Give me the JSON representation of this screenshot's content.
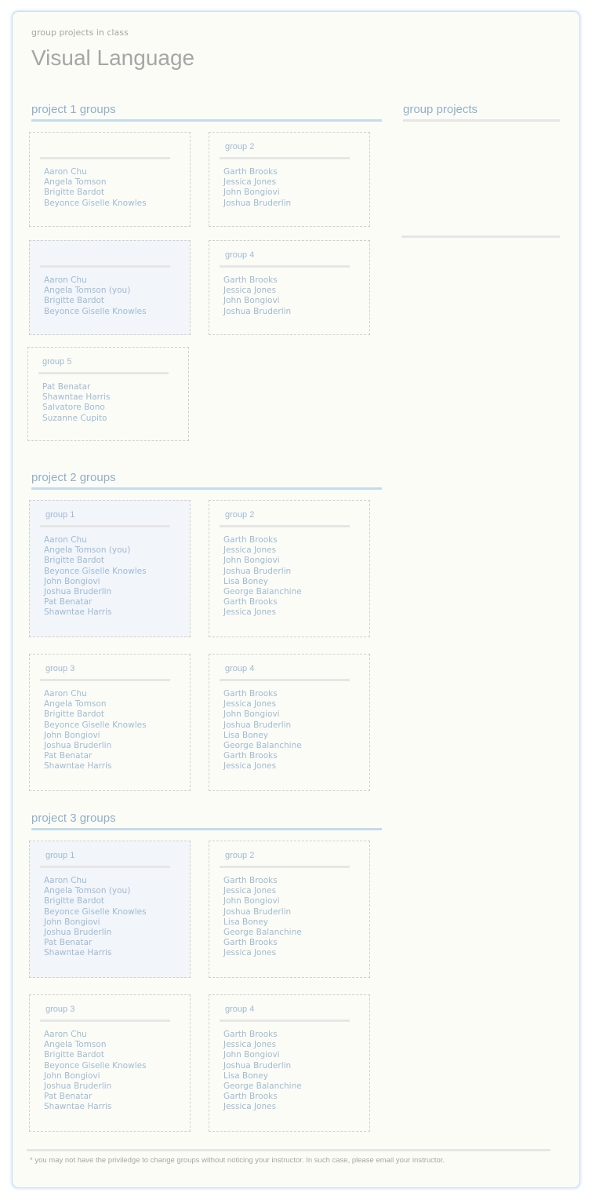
{
  "header": {
    "subtitle": "group projects in class",
    "title": "Visual Language"
  },
  "sidebar": {
    "heading": "group projects"
  },
  "projects": [
    {
      "heading": "project 1 groups",
      "groups": [
        {
          "name": "",
          "members": [
            "Aaron Chu",
            "Angela Tomson",
            "Brigitte Bardot",
            "Beyonce Giselle Knowles"
          ],
          "current": false
        },
        {
          "name": "group 2",
          "members": [
            "Garth Brooks",
            "Jessica Jones",
            "John Bongiovi",
            "Joshua Bruderlin"
          ],
          "current": false
        },
        {
          "name": "",
          "members": [
            "Aaron Chu",
            "Angela Tomson (you)",
            "Brigitte Bardot",
            "Beyonce Giselle Knowles"
          ],
          "current": true
        },
        {
          "name": "group 4",
          "members": [
            "Garth Brooks",
            "Jessica Jones",
            "John Bongiovi",
            "Joshua Bruderlin"
          ],
          "current": false
        },
        {
          "name": "group 5",
          "members": [
            "Pat Benatar",
            "Shawntae Harris",
            "Salvatore Bono",
            "Suzanne Cupito"
          ],
          "current": false
        }
      ]
    },
    {
      "heading": "project 2 groups",
      "groups": [
        {
          "name": "group 1",
          "members": [
            "Aaron Chu",
            "Angela Tomson (you)",
            "Brigitte Bardot",
            "Beyonce Giselle Knowles",
            "John Bongiovi",
            "Joshua Bruderlin",
            "Pat Benatar",
            "Shawntae Harris"
          ],
          "current": true
        },
        {
          "name": "group 2",
          "members": [
            "Garth Brooks",
            "Jessica Jones",
            "John Bongiovi",
            "Joshua Bruderlin",
            "Lisa Boney",
            "George Balanchine",
            "Garth Brooks",
            "Jessica Jones"
          ],
          "current": false
        },
        {
          "name": "group 3",
          "members": [
            "Aaron Chu",
            "Angela Tomson",
            "Brigitte Bardot",
            "Beyonce Giselle Knowles",
            "John Bongiovi",
            "Joshua Bruderlin",
            "Pat Benatar",
            "Shawntae Harris"
          ],
          "current": false
        },
        {
          "name": "group 4",
          "members": [
            "Garth Brooks",
            "Jessica Jones",
            "John Bongiovi",
            "Joshua Bruderlin",
            "Lisa Boney",
            "George Balanchine",
            "Garth Brooks",
            "Jessica Jones"
          ],
          "current": false
        }
      ]
    },
    {
      "heading": "project 3 groups",
      "groups": [
        {
          "name": "group 1",
          "members": [
            "Aaron Chu",
            "Angela Tomson (you)",
            "Brigitte Bardot",
            "Beyonce Giselle Knowles",
            "John Bongiovi",
            "Joshua Bruderlin",
            "Pat Benatar",
            "Shawntae Harris"
          ],
          "current": true
        },
        {
          "name": "group 2",
          "members": [
            "Garth Brooks",
            "Jessica Jones",
            "John Bongiovi",
            "Joshua Bruderlin",
            "Lisa Boney",
            "George Balanchine",
            "Garth Brooks",
            "Jessica Jones"
          ],
          "current": false
        },
        {
          "name": "group 3",
          "members": [
            "Aaron Chu",
            "Angela Tomson",
            "Brigitte Bardot",
            "Beyonce Giselle Knowles",
            "John Bongiovi",
            "Joshua Bruderlin",
            "Pat Benatar",
            "Shawntae Harris"
          ],
          "current": false
        },
        {
          "name": "group 4",
          "members": [
            "Garth Brooks",
            "Jessica Jones",
            "John Bongiovi",
            "Joshua Bruderlin",
            "Lisa Boney",
            "George Balanchine",
            "Garth Brooks",
            "Jessica Jones"
          ],
          "current": false
        }
      ]
    }
  ],
  "footer": {
    "note": "* you may not have the priviledge to change groups without noticing your instructor. In such case, please email your instructor."
  }
}
